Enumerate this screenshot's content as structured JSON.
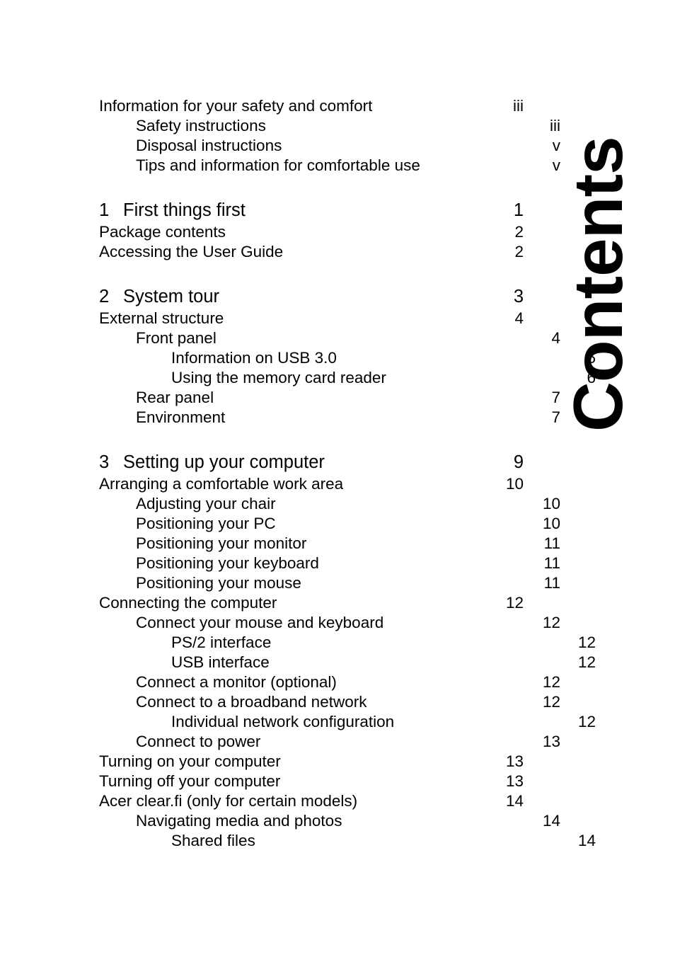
{
  "document": {
    "side_title": "Contents"
  },
  "toc": {
    "entries": [
      {
        "level": 0,
        "chapter": false,
        "number": "",
        "title": "Information for your safety and comfort",
        "page": "iii",
        "gap_before": false
      },
      {
        "level": 1,
        "chapter": false,
        "number": "",
        "title": "Safety instructions",
        "page": "iii",
        "gap_before": false
      },
      {
        "level": 1,
        "chapter": false,
        "number": "",
        "title": "Disposal instructions",
        "page": "v",
        "gap_before": false
      },
      {
        "level": 1,
        "chapter": false,
        "number": "",
        "title": "Tips and information for comfortable use",
        "page": "v",
        "gap_before": false
      },
      {
        "level": 0,
        "chapter": true,
        "number": "1",
        "title": "First things first",
        "page": "1",
        "gap_before": true
      },
      {
        "level": 0,
        "chapter": false,
        "number": "",
        "title": "Package contents",
        "page": "2",
        "gap_before": false
      },
      {
        "level": 0,
        "chapter": false,
        "number": "",
        "title": "Accessing the User Guide",
        "page": "2",
        "gap_before": false
      },
      {
        "level": 0,
        "chapter": true,
        "number": "2",
        "title": "System tour",
        "page": "3",
        "gap_before": true
      },
      {
        "level": 0,
        "chapter": false,
        "number": "",
        "title": "External structure",
        "page": "4",
        "gap_before": false
      },
      {
        "level": 1,
        "chapter": false,
        "number": "",
        "title": "Front panel",
        "page": "4",
        "gap_before": false
      },
      {
        "level": 2,
        "chapter": false,
        "number": "",
        "title": "Information on USB 3.0",
        "page": "5",
        "gap_before": false
      },
      {
        "level": 2,
        "chapter": false,
        "number": "",
        "title": "Using the memory card reader",
        "page": "6",
        "gap_before": false
      },
      {
        "level": 1,
        "chapter": false,
        "number": "",
        "title": "Rear panel",
        "page": "7",
        "gap_before": false
      },
      {
        "level": 1,
        "chapter": false,
        "number": "",
        "title": "Environment",
        "page": "7",
        "gap_before": false
      },
      {
        "level": 0,
        "chapter": true,
        "number": "3",
        "title": "Setting up your computer",
        "page": "9",
        "gap_before": true
      },
      {
        "level": 0,
        "chapter": false,
        "number": "",
        "title": "Arranging a comfortable work area",
        "page": "10",
        "gap_before": false
      },
      {
        "level": 1,
        "chapter": false,
        "number": "",
        "title": "Adjusting your chair",
        "page": "10",
        "gap_before": false
      },
      {
        "level": 1,
        "chapter": false,
        "number": "",
        "title": "Positioning your PC",
        "page": "10",
        "gap_before": false
      },
      {
        "level": 1,
        "chapter": false,
        "number": "",
        "title": "Positioning your monitor",
        "page": "11",
        "gap_before": false
      },
      {
        "level": 1,
        "chapter": false,
        "number": "",
        "title": "Positioning your keyboard",
        "page": "11",
        "gap_before": false
      },
      {
        "level": 1,
        "chapter": false,
        "number": "",
        "title": "Positioning your mouse",
        "page": "11",
        "gap_before": false
      },
      {
        "level": 0,
        "chapter": false,
        "number": "",
        "title": "Connecting the computer",
        "page": "12",
        "gap_before": false
      },
      {
        "level": 1,
        "chapter": false,
        "number": "",
        "title": "Connect your mouse and keyboard",
        "page": "12",
        "gap_before": false
      },
      {
        "level": 2,
        "chapter": false,
        "number": "",
        "title": "PS/2 interface",
        "page": "12",
        "gap_before": false
      },
      {
        "level": 2,
        "chapter": false,
        "number": "",
        "title": "USB interface",
        "page": "12",
        "gap_before": false
      },
      {
        "level": 1,
        "chapter": false,
        "number": "",
        "title": "Connect a monitor (optional)",
        "page": "12",
        "gap_before": false
      },
      {
        "level": 1,
        "chapter": false,
        "number": "",
        "title": "Connect to a broadband network",
        "page": "12",
        "gap_before": false
      },
      {
        "level": 2,
        "chapter": false,
        "number": "",
        "title": "Individual network configuration",
        "page": "12",
        "gap_before": false
      },
      {
        "level": 1,
        "chapter": false,
        "number": "",
        "title": "Connect to power",
        "page": "13",
        "gap_before": false
      },
      {
        "level": 0,
        "chapter": false,
        "number": "",
        "title": "Turning on your computer",
        "page": "13",
        "gap_before": false
      },
      {
        "level": 0,
        "chapter": false,
        "number": "",
        "title": "Turning off your computer",
        "page": "13",
        "gap_before": false
      },
      {
        "level": 0,
        "chapter": false,
        "number": "",
        "title": "Acer clear.fi (only for certain models)",
        "page": "14",
        "gap_before": false
      },
      {
        "level": 1,
        "chapter": false,
        "number": "",
        "title": "Navigating media and photos",
        "page": "14",
        "gap_before": false
      },
      {
        "level": 2,
        "chapter": false,
        "number": "",
        "title": "Shared files",
        "page": "14",
        "gap_before": false
      }
    ]
  }
}
